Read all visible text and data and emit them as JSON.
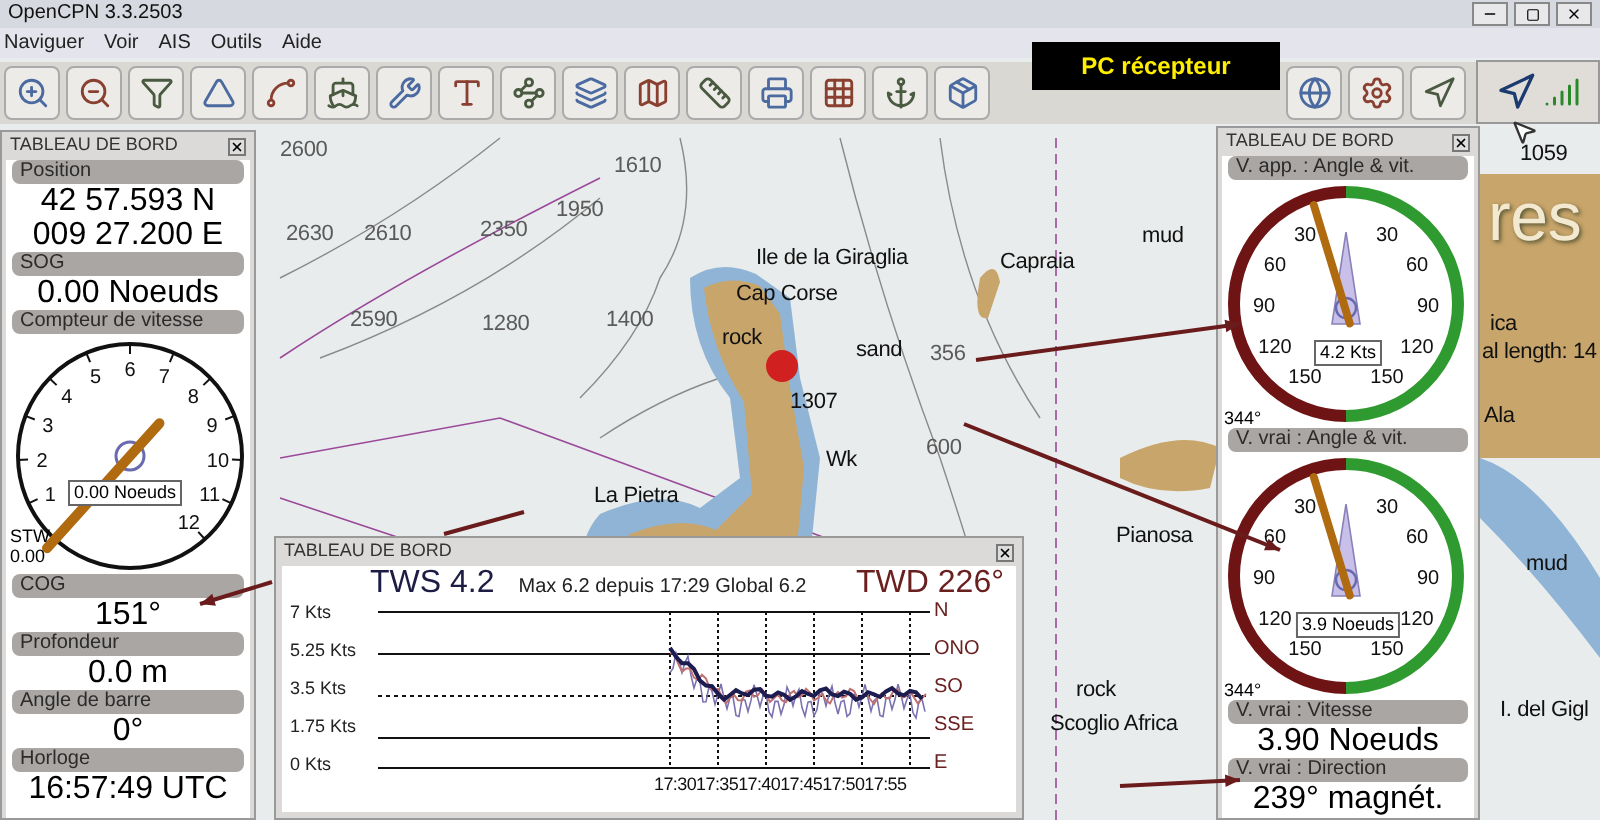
{
  "window": {
    "title": "OpenCPN 3.3.2503"
  },
  "menu": [
    "Naviguer",
    "Voir",
    "AIS",
    "Outils",
    "Aide"
  ],
  "callout": "PC récepteur",
  "chart_labels": [
    {
      "text": "2600",
      "kind": "depth"
    },
    {
      "text": "2630",
      "kind": "depth"
    },
    {
      "text": "2610",
      "kind": "depth"
    },
    {
      "text": "2350",
      "kind": "depth"
    },
    {
      "text": "1950",
      "kind": "depth"
    },
    {
      "text": "1610",
      "kind": "depth"
    },
    {
      "text": "2590",
      "kind": "depth"
    },
    {
      "text": "1280",
      "kind": "depth"
    },
    {
      "text": "1400",
      "kind": "depth"
    },
    {
      "text": "Ile de la Giraglia",
      "kind": "name"
    },
    {
      "text": "Cap Corse",
      "kind": "name"
    },
    {
      "text": "rock",
      "kind": "name"
    },
    {
      "text": "sand",
      "kind": "name"
    },
    {
      "text": "356",
      "kind": "depth"
    },
    {
      "text": "Capraia",
      "kind": "name"
    },
    {
      "text": "1307",
      "kind": "name"
    },
    {
      "text": "Wk",
      "kind": "name"
    },
    {
      "text": "600",
      "kind": "depth"
    },
    {
      "text": "La Pietra",
      "kind": "name"
    },
    {
      "text": "mud",
      "kind": "name"
    },
    {
      "text": "Pianosa",
      "kind": "name"
    },
    {
      "text": "rock",
      "kind": "name"
    },
    {
      "text": "Scoglio Africa",
      "kind": "name"
    },
    {
      "text": "1059",
      "kind": "name"
    },
    {
      "text": "res",
      "kind": "title"
    },
    {
      "text": "ica",
      "kind": "name"
    },
    {
      "text": "al length: 14",
      "kind": "name"
    },
    {
      "text": "Ala",
      "kind": "name"
    },
    {
      "text": "mud",
      "kind": "name"
    },
    {
      "text": "I. del Gigl",
      "kind": "name"
    }
  ],
  "left_panel": {
    "title": "TABLEAU DE BORD",
    "sections": [
      {
        "kind": "text",
        "label": "Position",
        "lines": [
          "42 57.593 N",
          "009 27.200 E"
        ]
      },
      {
        "kind": "text",
        "label": "SOG",
        "lines": [
          "0.00 Noeuds"
        ]
      },
      {
        "kind": "speedometer",
        "label": "Compteur de vitesse",
        "dial_labels": [
          "1",
          "2",
          "3",
          "4",
          "5",
          "6",
          "7",
          "8",
          "9",
          "10",
          "11",
          "12"
        ],
        "reading": "0.00 Noeuds",
        "stw_label": "STW",
        "stw_value": "0.00"
      },
      {
        "kind": "text",
        "label": "COG",
        "lines": [
          "151°"
        ]
      },
      {
        "kind": "text",
        "label": "Profondeur",
        "lines": [
          "0.0 m"
        ]
      },
      {
        "kind": "text",
        "label": "Angle de barre",
        "lines": [
          "0°"
        ]
      },
      {
        "kind": "text",
        "label": "Horloge",
        "lines": [
          "16:57:49 UTC"
        ]
      }
    ]
  },
  "right_panel": {
    "title": "TABLEAU DE BORD",
    "sections": [
      {
        "kind": "wind_dial",
        "label": "V. app. : Angle & vit.",
        "left_labels": [
          "30",
          "60",
          "90",
          "120",
          "150"
        ],
        "right_labels": [
          "30",
          "60",
          "90",
          "120",
          "150"
        ],
        "reading": "4.2 Kts",
        "heading": "344°"
      },
      {
        "kind": "wind_dial",
        "label": "V. vrai : Angle & vit.",
        "left_labels": [
          "30",
          "60",
          "90",
          "120",
          "150"
        ],
        "right_labels": [
          "30",
          "60",
          "90",
          "120",
          "150"
        ],
        "reading": "3.9 Noeuds",
        "heading": "344°"
      },
      {
        "kind": "text",
        "label": "V. vrai : Vitesse",
        "lines": [
          "3.90 Noeuds"
        ]
      },
      {
        "kind": "text",
        "label": "V. vrai : Direction",
        "lines": [
          "239° magnét."
        ]
      }
    ]
  },
  "wind_panel": {
    "title": "TABLEAU DE BORD",
    "tws": "TWS 4.2",
    "info": "Max 6.2 depuis  17:29 Global 6.2",
    "twd": "TWD 226°",
    "speed_labels": [
      "7 Kts",
      "5.25 Kts",
      "3.5 Kts",
      "1.75 Kts",
      "0 Kts"
    ],
    "direction_labels": [
      "N",
      "ONO",
      "SO",
      "SSE",
      "E"
    ],
    "time_labels": [
      "17:30",
      "17:35",
      "17:40",
      "17:45",
      "17:50",
      "17:55"
    ]
  }
}
